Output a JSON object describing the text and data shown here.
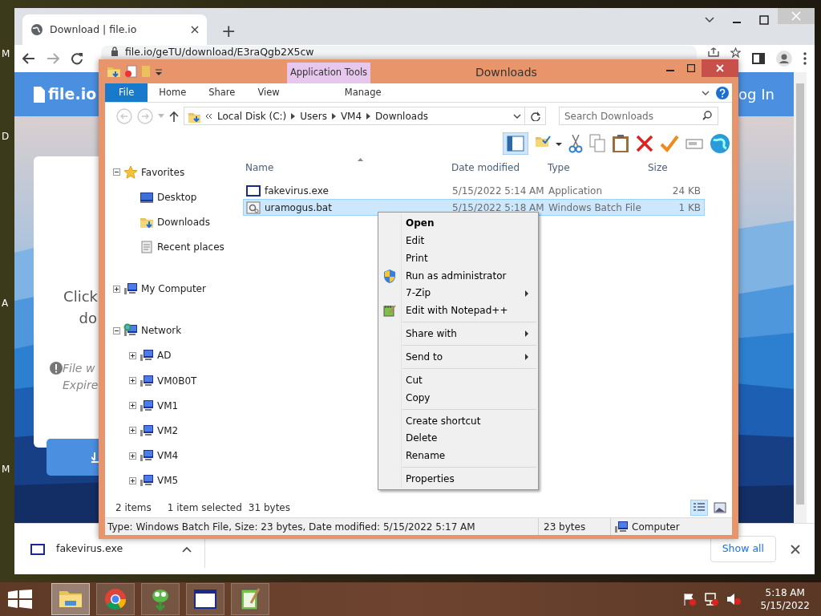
{
  "desktop": {
    "icon_labels": [
      "M",
      "D",
      "A",
      "M"
    ]
  },
  "browser": {
    "tabs": [
      {
        "title": "Download | file.io",
        "selected": true
      }
    ],
    "new_tab": "+",
    "address": "file.io/geTU/download/E3raQgb2X5cw",
    "page": {
      "logo": "file.io",
      "login": "og In",
      "prompt": [
        "Click",
        "do"
      ],
      "notice": [
        "File w",
        "Expire"
      ]
    },
    "downloads": [
      {
        "file": "fakevirus.exe"
      }
    ],
    "show_all": "Show all"
  },
  "explorer": {
    "title": "Downloads",
    "context_tab": "Application Tools",
    "ribbon_tabs": [
      {
        "label": "File",
        "kind": "file",
        "selected": false
      },
      {
        "label": "Home",
        "kind": "tab",
        "selected": false
      },
      {
        "label": "Share",
        "kind": "tab",
        "selected": false
      },
      {
        "label": "View",
        "kind": "tab",
        "selected": false
      },
      {
        "label": "Manage",
        "kind": "context",
        "selected": false
      }
    ],
    "breadcrumb": [
      "Local Disk (C:)",
      "Users",
      "VM4",
      "Downloads"
    ],
    "search": {
      "placeholder": "Search Downloads"
    },
    "tree": [
      {
        "label": "Favorites",
        "kind": "favorites",
        "expanded": true,
        "children": [
          {
            "label": "Desktop",
            "kind": "desktop"
          },
          {
            "label": "Downloads",
            "kind": "downloads"
          },
          {
            "label": "Recent places",
            "kind": "recent"
          }
        ]
      },
      {
        "label": "My Computer",
        "kind": "computer",
        "expanded": false
      },
      {
        "label": "Network",
        "kind": "network",
        "expanded": true,
        "children": [
          {
            "label": "AD",
            "kind": "computer",
            "expanded": false
          },
          {
            "label": "VM0B0T",
            "kind": "computer",
            "expanded": false
          },
          {
            "label": "VM1",
            "kind": "computer",
            "expanded": false
          },
          {
            "label": "VM2",
            "kind": "computer",
            "expanded": false
          },
          {
            "label": "VM4",
            "kind": "computer",
            "expanded": false
          },
          {
            "label": "VM5",
            "kind": "computer",
            "expanded": false
          }
        ]
      }
    ],
    "columns": [
      "Name",
      "Date modified",
      "Type",
      "Size"
    ],
    "files": [
      {
        "name": "fakevirus.exe",
        "kind": "app",
        "date": "5/15/2022 5:14 AM",
        "type": "Application",
        "size": "24 KB",
        "selected": false
      },
      {
        "name": "uramogus.bat",
        "kind": "batch",
        "date": "5/15/2022 5:18 AM",
        "type": "Windows Batch File",
        "size": "1 KB",
        "selected": true
      }
    ],
    "status": [
      "2 items",
      "1 item selected",
      "31 bytes"
    ],
    "views": [
      {
        "kind": "details",
        "selected": true
      },
      {
        "kind": "thumbnails",
        "selected": false
      }
    ],
    "details": {
      "summary": "Type: Windows Batch File, Size: 23 bytes, Date modified: 5/15/2022 5:17 AM",
      "size": "23 bytes",
      "location": "Computer"
    }
  },
  "context_menu": [
    {
      "kind": "item",
      "label": "Open",
      "default": true
    },
    {
      "kind": "item",
      "label": "Edit"
    },
    {
      "kind": "item",
      "label": "Print"
    },
    {
      "kind": "admin",
      "label": "Run as administrator"
    },
    {
      "kind": "item",
      "label": "7-Zip",
      "submenu": true
    },
    {
      "kind": "editor",
      "label": "Edit with Notepad++"
    },
    {
      "kind": "separator"
    },
    {
      "kind": "item",
      "label": "Share with",
      "submenu": true
    },
    {
      "kind": "separator"
    },
    {
      "kind": "item",
      "label": "Send to",
      "submenu": true
    },
    {
      "kind": "separator"
    },
    {
      "kind": "item",
      "label": "Cut"
    },
    {
      "kind": "item",
      "label": "Copy"
    },
    {
      "kind": "separator"
    },
    {
      "kind": "item",
      "label": "Create shortcut"
    },
    {
      "kind": "item",
      "label": "Delete"
    },
    {
      "kind": "item",
      "label": "Rename"
    },
    {
      "kind": "separator"
    },
    {
      "kind": "item",
      "label": "Properties"
    }
  ],
  "taskbar": {
    "apps": [
      {
        "kind": "folder",
        "selected": true
      },
      {
        "kind": "browser",
        "selected": false
      },
      {
        "kind": "gecko",
        "selected": false
      },
      {
        "kind": "window",
        "selected": false
      },
      {
        "kind": "notepad",
        "selected": false
      }
    ],
    "time": "5:18 AM",
    "date": "5/15/2022"
  }
}
